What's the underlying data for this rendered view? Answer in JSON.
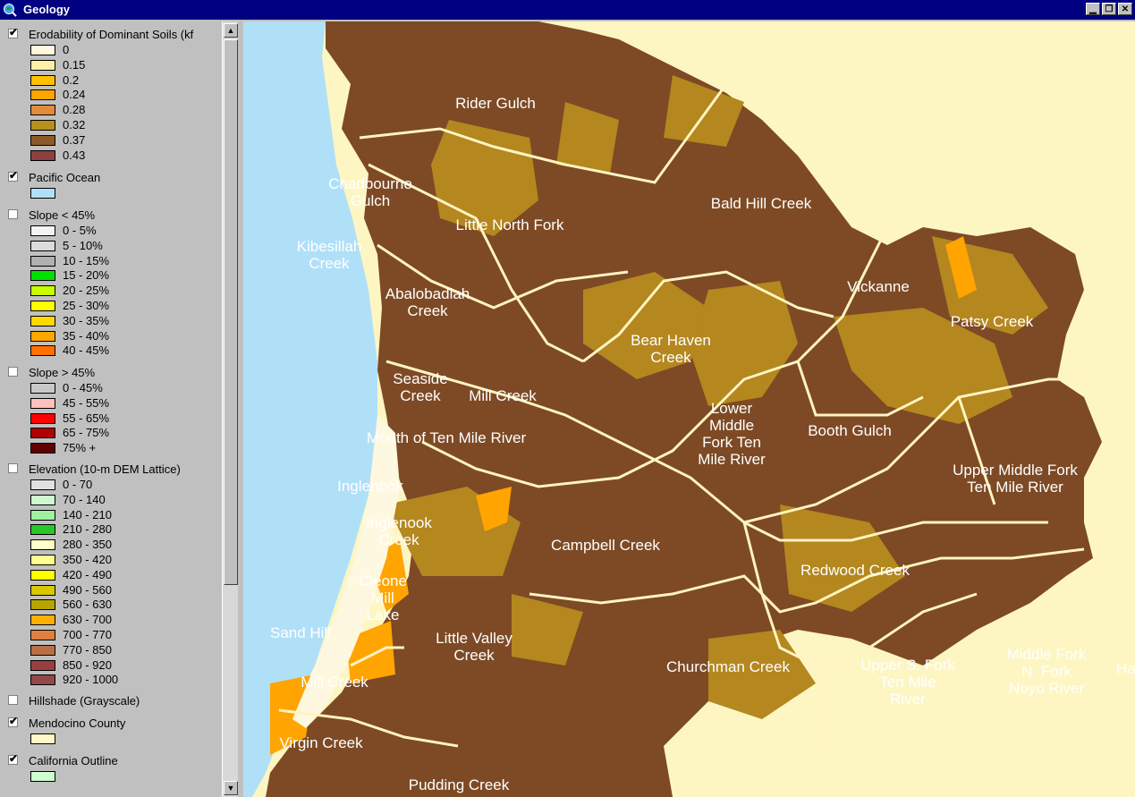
{
  "window": {
    "title": "Geology"
  },
  "legend": {
    "layers": [
      {
        "name": "Erodability of Dominant Soils (kf",
        "checked": true,
        "entries": [
          {
            "label": "0",
            "color": "#fff8e0"
          },
          {
            "label": "0.15",
            "color": "#fff0a8"
          },
          {
            "label": "0.2",
            "color": "#ffc000"
          },
          {
            "label": "0.24",
            "color": "#ffa400"
          },
          {
            "label": "0.28",
            "color": "#e08c3c"
          },
          {
            "label": "0.32",
            "color": "#b8901c"
          },
          {
            "label": "0.37",
            "color": "#8c5a28"
          },
          {
            "label": "0.43",
            "color": "#8c4040"
          }
        ]
      },
      {
        "name": "Pacific Ocean",
        "checked": true,
        "entries": [
          {
            "label": "",
            "color": "#b0e0f8"
          }
        ]
      },
      {
        "name": "Slope < 45%",
        "checked": false,
        "entries": [
          {
            "label": "0 - 5%",
            "color": "#f4f4f4"
          },
          {
            "label": "5 - 10%",
            "color": "#dcdcdc"
          },
          {
            "label": "10 - 15%",
            "color": "#b0b0b0"
          },
          {
            "label": "15 - 20%",
            "color": "#00e000"
          },
          {
            "label": "20 - 25%",
            "color": "#c8ff00"
          },
          {
            "label": "25 - 30%",
            "color": "#ffff00"
          },
          {
            "label": "30 - 35%",
            "color": "#ffd800"
          },
          {
            "label": "35 - 40%",
            "color": "#ffa800"
          },
          {
            "label": "40 - 45%",
            "color": "#ff7000"
          }
        ]
      },
      {
        "name": "Slope > 45%",
        "checked": false,
        "entries": [
          {
            "label": "0 - 45%",
            "color": "#c8c8c8"
          },
          {
            "label": "45 - 55%",
            "color": "#ffc0c0"
          },
          {
            "label": "55 - 65%",
            "color": "#ff0000"
          },
          {
            "label": "65 - 75%",
            "color": "#b00000"
          },
          {
            "label": "75% +",
            "color": "#600000"
          }
        ]
      },
      {
        "name": "Elevation (10-m DEM Lattice)",
        "checked": false,
        "entries": [
          {
            "label": "0 - 70",
            "color": "#e0e0e0"
          },
          {
            "label": "70 - 140",
            "color": "#d0f8d0"
          },
          {
            "label": "140 - 210",
            "color": "#a0f0a0"
          },
          {
            "label": "210 - 280",
            "color": "#28c828"
          },
          {
            "label": "280 - 350",
            "color": "#ffffc8"
          },
          {
            "label": "350 - 420",
            "color": "#ffff90"
          },
          {
            "label": "420 - 490",
            "color": "#ffff00"
          },
          {
            "label": "490 - 560",
            "color": "#d8c800"
          },
          {
            "label": "560 - 630",
            "color": "#b8a400"
          },
          {
            "label": "630 - 700",
            "color": "#ffb000"
          },
          {
            "label": "700 - 770",
            "color": "#e08040"
          },
          {
            "label": "770 - 850",
            "color": "#b87048"
          },
          {
            "label": "850 - 920",
            "color": "#984040"
          },
          {
            "label": "920 - 1000",
            "color": "#904848"
          }
        ]
      },
      {
        "name": "Hillshade (Grayscale)",
        "checked": false,
        "entries": []
      },
      {
        "name": "Mendocino County",
        "checked": true,
        "entries": [
          {
            "label": "",
            "color": "#fff8c8"
          }
        ]
      },
      {
        "name": "California Outline",
        "checked": true,
        "entries": [
          {
            "label": "",
            "color": "#d0ffd0"
          }
        ]
      }
    ]
  },
  "map": {
    "colors": {
      "ocean": "#b0e0f8",
      "county": "#fdf6c3",
      "dark_soil": "#7d4a25",
      "mid_soil": "#b4871f",
      "streams": "#fff4c0"
    },
    "labels": [
      "Rider Gulch",
      "Chadbourne\nGulch",
      "Bald Hill Creek",
      "Little North Fork",
      "Kibesillah\nCreek",
      "Abalobadiah\nCreek",
      "Vickanne",
      "Patsy Creek",
      "Bear Haven\nCreek",
      "Seaside\nCreek",
      "Mill Creek",
      "Lower\nMiddle\nFork Ten\nMile River",
      "Booth Gulch",
      "Mouth of Ten Mile River",
      "Upper Middle Fork\nTen Mile River",
      "Inglenook",
      "Inglenook\nCreek",
      "Campbell Creek",
      "Redwood Creek",
      "Cleone\nMill\nLake",
      "Sand Hill",
      "Little Valley\nCreek",
      "Churchman Creek",
      "Upper S. Fork\nTen Mile\nRiver",
      "Middle Fork\nN. Fork\nNoyo River",
      "Ha",
      "Mill Creek",
      "Virgin Creek",
      "Pudding Creek"
    ]
  }
}
